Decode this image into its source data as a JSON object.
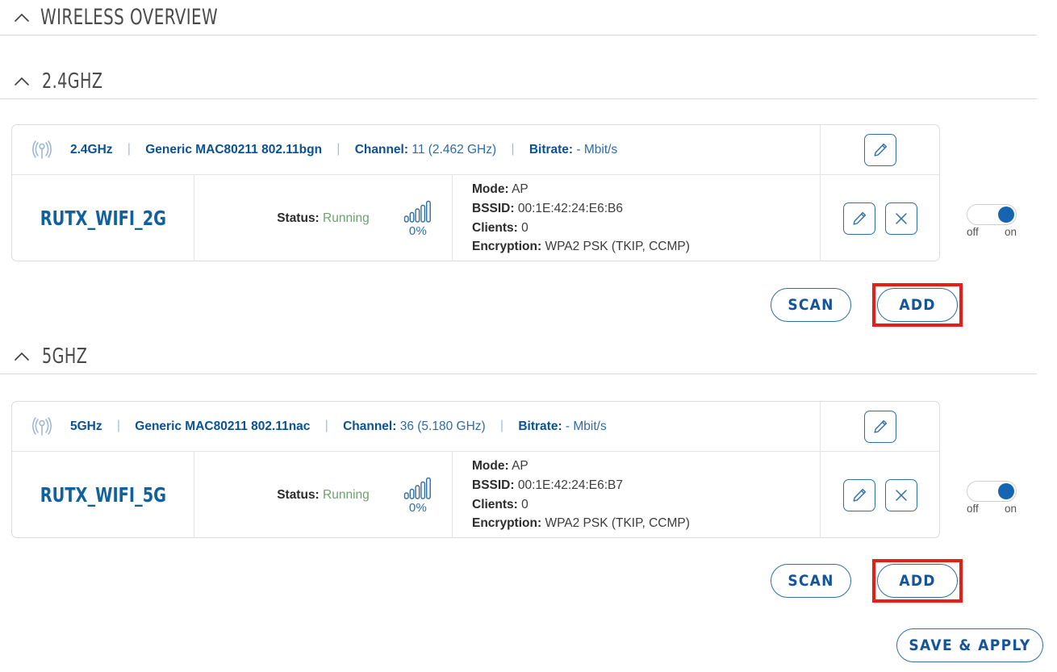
{
  "page": {
    "title": "WIRELESS OVERVIEW",
    "collapse_icon": "chevron-up-icon"
  },
  "colors": {
    "link_blue": "#15539a",
    "accent_blue": "#1565b0",
    "status_green": "#6fa06f",
    "highlight_red": "#e81e16",
    "border_grey": "#dcdcdc"
  },
  "sections": [
    {
      "heading": "2.4GHZ",
      "radio": {
        "antenna_icon": "wireless-antenna-icon",
        "band": "2.4GHz",
        "driver": "Generic MAC80211 802.11bgn",
        "channel_label": "Channel:",
        "channel_value": "11 (2.462 GHz)",
        "bitrate_label": "Bitrate:",
        "bitrate_value": "- Mbit/s",
        "edit_icon": "pencil-icon"
      },
      "interface": {
        "ssid": "RUTX_WIFI_2G",
        "status_label": "Status:",
        "status_value": "Running",
        "signal_icon": "signal-bars-icon",
        "signal_percent": "0%",
        "mode_label": "Mode:",
        "mode_value": "AP",
        "bssid_label": "BSSID:",
        "bssid_value": "00:1E:42:24:E6:B6",
        "clients_label": "Clients:",
        "clients_value": "0",
        "encryption_label": "Encryption:",
        "encryption_value": "WPA2 PSK (TKIP, CCMP)",
        "edit_icon": "pencil-icon",
        "remove_icon": "close-x-icon",
        "toggle_state": "on",
        "toggle_off_label": "off",
        "toggle_on_label": "on"
      },
      "buttons": {
        "scan": "SCAN",
        "add": "ADD",
        "add_highlighted": true
      }
    },
    {
      "heading": "5GHZ",
      "radio": {
        "antenna_icon": "wireless-antenna-icon",
        "band": "5GHz",
        "driver": "Generic MAC80211 802.11nac",
        "channel_label": "Channel:",
        "channel_value": "36 (5.180 GHz)",
        "bitrate_label": "Bitrate:",
        "bitrate_value": "- Mbit/s",
        "edit_icon": "pencil-icon"
      },
      "interface": {
        "ssid": "RUTX_WIFI_5G",
        "status_label": "Status:",
        "status_value": "Running",
        "signal_icon": "signal-bars-icon",
        "signal_percent": "0%",
        "mode_label": "Mode:",
        "mode_value": "AP",
        "bssid_label": "BSSID:",
        "bssid_value": "00:1E:42:24:E6:B7",
        "clients_label": "Clients:",
        "clients_value": "0",
        "encryption_label": "Encryption:",
        "encryption_value": "WPA2 PSK (TKIP, CCMP)",
        "edit_icon": "pencil-icon",
        "remove_icon": "close-x-icon",
        "toggle_state": "on",
        "toggle_off_label": "off",
        "toggle_on_label": "on"
      },
      "buttons": {
        "scan": "SCAN",
        "add": "ADD",
        "add_highlighted": true
      }
    }
  ],
  "footer": {
    "save_apply": "SAVE & APPLY"
  }
}
